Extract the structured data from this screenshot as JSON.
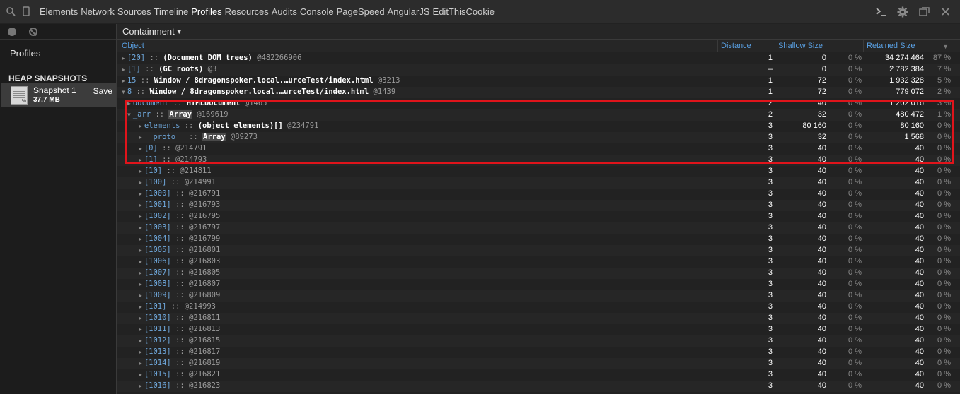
{
  "toolbar": {
    "tabs": [
      "Elements",
      "Network",
      "Sources",
      "Timeline",
      "Profiles",
      "Resources",
      "Audits",
      "Console",
      "PageSpeed",
      "AngularJS",
      "EditThisCookie"
    ],
    "active_tab": "Profiles"
  },
  "sidebar": {
    "title": "Profiles",
    "section": "HEAP SNAPSHOTS",
    "snapshot": {
      "name": "Snapshot 1",
      "size": "37.7 MB",
      "save": "Save"
    }
  },
  "main": {
    "view": "Containment",
    "columns": {
      "object": "Object",
      "distance": "Distance",
      "shallow": "Shallow Size",
      "retained": "Retained Size"
    }
  },
  "rows": [
    {
      "indent": 0,
      "tri": "▶",
      "name": "[20]",
      "ctor": "(Document DOM trees)",
      "id": "@482266906",
      "dist": "1",
      "shal": "0",
      "shalp": "0 %",
      "ret": "34 274 464",
      "retp": "87 %"
    },
    {
      "indent": 0,
      "tri": "▶",
      "name": "[1]",
      "ctor": "(GC roots)",
      "id": "@3",
      "dist": "–",
      "shal": "0",
      "shalp": "0 %",
      "ret": "2 782 384",
      "retp": "7 %"
    },
    {
      "indent": 0,
      "tri": "▶",
      "name": "15",
      "ctor": "Window / 8dragonspoker.local.…urceTest/index.html",
      "id": "@3213",
      "dist": "1",
      "shal": "72",
      "shalp": "0 %",
      "ret": "1 932 328",
      "retp": "5 %"
    },
    {
      "indent": 0,
      "tri": "▼",
      "name": "8",
      "ctor": "Window / 8dragonspoker.local.…urceTest/index.html",
      "id": "@1439",
      "dist": "1",
      "shal": "72",
      "shalp": "0 %",
      "ret": "779 072",
      "retp": "2 %"
    },
    {
      "indent": 1,
      "tri": "▶",
      "name": "document",
      "ctor": "HTMLDocument",
      "id": "@1465",
      "dist": "2",
      "shal": "40",
      "shalp": "0 %",
      "ret": "1 202 016",
      "retp": "3 %"
    },
    {
      "indent": 1,
      "tri": "▼",
      "name": "_arr",
      "ctor": "Array",
      "id": "@169619",
      "dist": "2",
      "shal": "32",
      "shalp": "0 %",
      "ret": "480 472",
      "retp": "1 %",
      "hl": true
    },
    {
      "indent": 2,
      "tri": "▶",
      "name": "elements",
      "ctor": "(object elements)[]",
      "id": "@234791",
      "dist": "3",
      "shal": "80 160",
      "shalp": "0 %",
      "ret": "80 160",
      "retp": "0 %"
    },
    {
      "indent": 2,
      "tri": "▶",
      "name": "__proto__",
      "ctor": "Array",
      "id": "@89273",
      "dist": "3",
      "shal": "32",
      "shalp": "0 %",
      "ret": "1 568",
      "retp": "0 %",
      "hl": true
    },
    {
      "indent": 2,
      "tri": "▶",
      "name": "[0]",
      "ctor": "",
      "id": "@214791",
      "dist": "3",
      "shal": "40",
      "shalp": "0 %",
      "ret": "40",
      "retp": "0 %"
    },
    {
      "indent": 2,
      "tri": "▶",
      "name": "[1]",
      "ctor": "",
      "id": "@214793",
      "dist": "3",
      "shal": "40",
      "shalp": "0 %",
      "ret": "40",
      "retp": "0 %"
    },
    {
      "indent": 2,
      "tri": "▶",
      "name": "[10]",
      "ctor": "",
      "id": "@214811",
      "dist": "3",
      "shal": "40",
      "shalp": "0 %",
      "ret": "40",
      "retp": "0 %"
    },
    {
      "indent": 2,
      "tri": "▶",
      "name": "[100]",
      "ctor": "",
      "id": "@214991",
      "dist": "3",
      "shal": "40",
      "shalp": "0 %",
      "ret": "40",
      "retp": "0 %"
    },
    {
      "indent": 2,
      "tri": "▶",
      "name": "[1000]",
      "ctor": "",
      "id": "@216791",
      "dist": "3",
      "shal": "40",
      "shalp": "0 %",
      "ret": "40",
      "retp": "0 %"
    },
    {
      "indent": 2,
      "tri": "▶",
      "name": "[1001]",
      "ctor": "",
      "id": "@216793",
      "dist": "3",
      "shal": "40",
      "shalp": "0 %",
      "ret": "40",
      "retp": "0 %"
    },
    {
      "indent": 2,
      "tri": "▶",
      "name": "[1002]",
      "ctor": "",
      "id": "@216795",
      "dist": "3",
      "shal": "40",
      "shalp": "0 %",
      "ret": "40",
      "retp": "0 %"
    },
    {
      "indent": 2,
      "tri": "▶",
      "name": "[1003]",
      "ctor": "",
      "id": "@216797",
      "dist": "3",
      "shal": "40",
      "shalp": "0 %",
      "ret": "40",
      "retp": "0 %"
    },
    {
      "indent": 2,
      "tri": "▶",
      "name": "[1004]",
      "ctor": "",
      "id": "@216799",
      "dist": "3",
      "shal": "40",
      "shalp": "0 %",
      "ret": "40",
      "retp": "0 %"
    },
    {
      "indent": 2,
      "tri": "▶",
      "name": "[1005]",
      "ctor": "",
      "id": "@216801",
      "dist": "3",
      "shal": "40",
      "shalp": "0 %",
      "ret": "40",
      "retp": "0 %"
    },
    {
      "indent": 2,
      "tri": "▶",
      "name": "[1006]",
      "ctor": "",
      "id": "@216803",
      "dist": "3",
      "shal": "40",
      "shalp": "0 %",
      "ret": "40",
      "retp": "0 %"
    },
    {
      "indent": 2,
      "tri": "▶",
      "name": "[1007]",
      "ctor": "",
      "id": "@216805",
      "dist": "3",
      "shal": "40",
      "shalp": "0 %",
      "ret": "40",
      "retp": "0 %"
    },
    {
      "indent": 2,
      "tri": "▶",
      "name": "[1008]",
      "ctor": "",
      "id": "@216807",
      "dist": "3",
      "shal": "40",
      "shalp": "0 %",
      "ret": "40",
      "retp": "0 %"
    },
    {
      "indent": 2,
      "tri": "▶",
      "name": "[1009]",
      "ctor": "",
      "id": "@216809",
      "dist": "3",
      "shal": "40",
      "shalp": "0 %",
      "ret": "40",
      "retp": "0 %"
    },
    {
      "indent": 2,
      "tri": "▶",
      "name": "[101]",
      "ctor": "",
      "id": "@214993",
      "dist": "3",
      "shal": "40",
      "shalp": "0 %",
      "ret": "40",
      "retp": "0 %"
    },
    {
      "indent": 2,
      "tri": "▶",
      "name": "[1010]",
      "ctor": "",
      "id": "@216811",
      "dist": "3",
      "shal": "40",
      "shalp": "0 %",
      "ret": "40",
      "retp": "0 %"
    },
    {
      "indent": 2,
      "tri": "▶",
      "name": "[1011]",
      "ctor": "",
      "id": "@216813",
      "dist": "3",
      "shal": "40",
      "shalp": "0 %",
      "ret": "40",
      "retp": "0 %"
    },
    {
      "indent": 2,
      "tri": "▶",
      "name": "[1012]",
      "ctor": "",
      "id": "@216815",
      "dist": "3",
      "shal": "40",
      "shalp": "0 %",
      "ret": "40",
      "retp": "0 %"
    },
    {
      "indent": 2,
      "tri": "▶",
      "name": "[1013]",
      "ctor": "",
      "id": "@216817",
      "dist": "3",
      "shal": "40",
      "shalp": "0 %",
      "ret": "40",
      "retp": "0 %"
    },
    {
      "indent": 2,
      "tri": "▶",
      "name": "[1014]",
      "ctor": "",
      "id": "@216819",
      "dist": "3",
      "shal": "40",
      "shalp": "0 %",
      "ret": "40",
      "retp": "0 %"
    },
    {
      "indent": 2,
      "tri": "▶",
      "name": "[1015]",
      "ctor": "",
      "id": "@216821",
      "dist": "3",
      "shal": "40",
      "shalp": "0 %",
      "ret": "40",
      "retp": "0 %"
    },
    {
      "indent": 2,
      "tri": "▶",
      "name": "[1016]",
      "ctor": "",
      "id": "@216823",
      "dist": "3",
      "shal": "40",
      "shalp": "0 %",
      "ret": "40",
      "retp": "0 %"
    }
  ],
  "colors": {
    "highlight_box": "#e0141b",
    "header_text": "#5aa2e6"
  }
}
